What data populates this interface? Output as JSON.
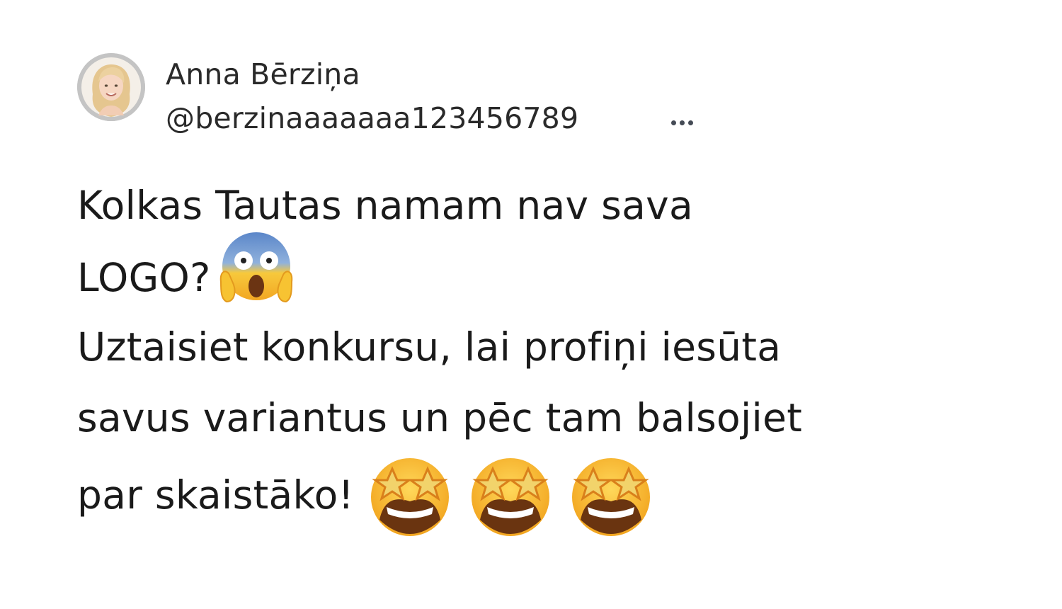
{
  "author": {
    "display_name": "Anna Bērziņa",
    "handle": "@berzinaaaaaaa123456789",
    "avatar": "profile-photo"
  },
  "actions": {
    "more_icon": "more-horizontal-icon"
  },
  "tweet": {
    "lines": [
      "Kolkas Tautas namam nav sava",
      "LOGO?",
      "Uztaisiet konkursu, lai profiņi iesūta",
      "savus variantus un pēc tam balsojiet",
      "par skaistāko!"
    ],
    "emojis": {
      "line2": "face-screaming-in-fear",
      "line5": [
        "star-struck",
        "star-struck",
        "star-struck"
      ]
    }
  },
  "colors": {
    "text": "#1a1a1a",
    "avatar_ring": "#c4c4c4",
    "emoji_yellow": "#f6c131"
  }
}
